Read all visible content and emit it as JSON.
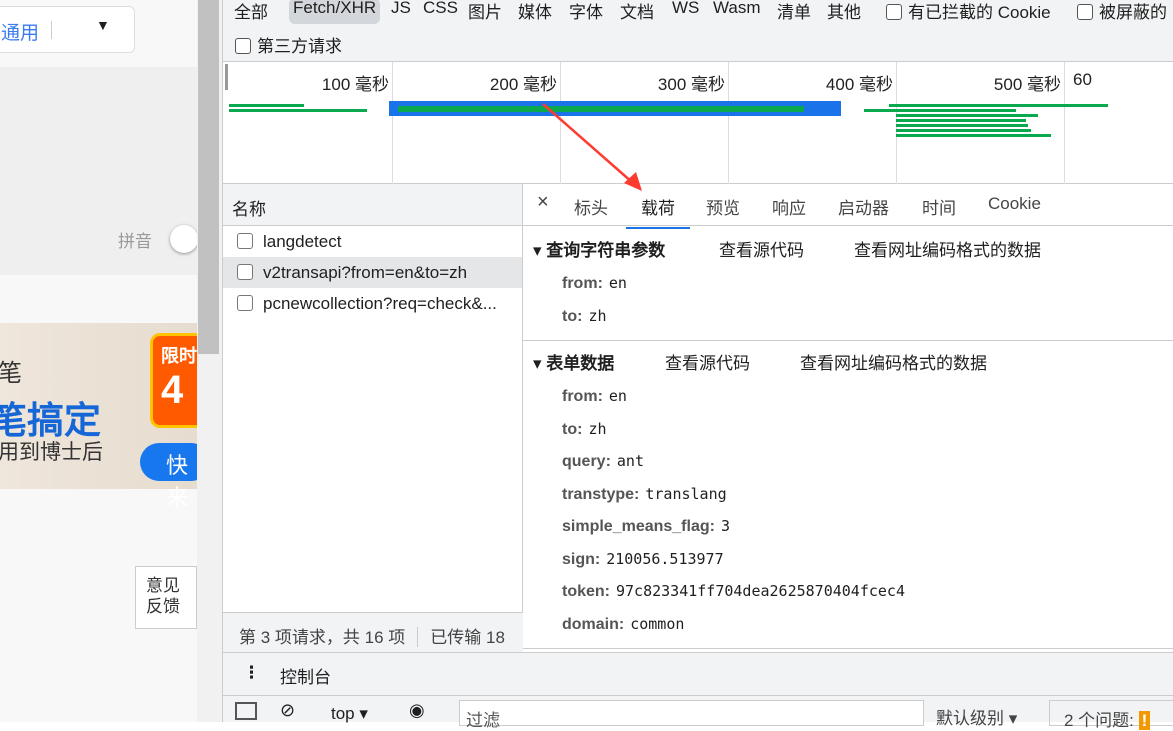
{
  "page": {
    "lang_label": "通用",
    "pinyin_label": "拼音",
    "banner": {
      "line1": "笔",
      "line2": "笔搞定",
      "line3": "用到博士后",
      "tag_top": "限时",
      "tag_num": "4",
      "button": "快来"
    },
    "feedback": "意见反馈"
  },
  "filters": {
    "items": [
      "全部",
      "Fetch/XHR",
      "JS",
      "CSS",
      "图片",
      "媒体",
      "字体",
      "文档",
      "WS",
      "Wasm",
      "清单",
      "其他"
    ],
    "selected": "Fetch/XHR",
    "blocked_cookies": "有已拦截的 Cookie",
    "blocked_requests": "被屏蔽的",
    "third_party": "第三方请求"
  },
  "timeline": {
    "ticks": [
      "100 毫秒",
      "200 毫秒",
      "300 毫秒",
      "400 毫秒",
      "500 毫秒",
      "60"
    ]
  },
  "requests": {
    "header": "名称",
    "items": [
      "langdetect",
      "v2transapi?from=en&to=zh",
      "pcnewcollection?req=check&..."
    ],
    "selected": 1,
    "status_count": "第 3 项请求，共 16 项",
    "status_transferred": "已传输 18"
  },
  "detail": {
    "tabs": [
      "标头",
      "载荷",
      "预览",
      "响应",
      "启动器",
      "时间",
      "Cookie"
    ],
    "active_tab": "载荷",
    "query": {
      "title": "查询字符串参数",
      "view_source": "查看源代码",
      "view_encoded": "查看网址编码格式的数据",
      "params": [
        {
          "k": "from",
          "v": "en"
        },
        {
          "k": "to",
          "v": "zh"
        }
      ]
    },
    "form": {
      "title": "表单数据",
      "view_source": "查看源代码",
      "view_encoded": "查看网址编码格式的数据",
      "params": [
        {
          "k": "from",
          "v": "en"
        },
        {
          "k": "to",
          "v": "zh"
        },
        {
          "k": "query",
          "v": "ant"
        },
        {
          "k": "transtype",
          "v": "translang"
        },
        {
          "k": "simple_means_flag",
          "v": "3"
        },
        {
          "k": "sign",
          "v": "210056.513977"
        },
        {
          "k": "token",
          "v": "97c823341ff704dea2625870404fcec4"
        },
        {
          "k": "domain",
          "v": "common"
        }
      ]
    }
  },
  "drawer": {
    "tab": "控制台"
  },
  "console": {
    "context": "top",
    "filter_placeholder": "过滤",
    "level": "默认级别",
    "issues": "2 个问题:"
  },
  "colors": {
    "accent": "#1a73e8",
    "waterfall": "#0aa84f",
    "arrow": "#ff3b30"
  }
}
